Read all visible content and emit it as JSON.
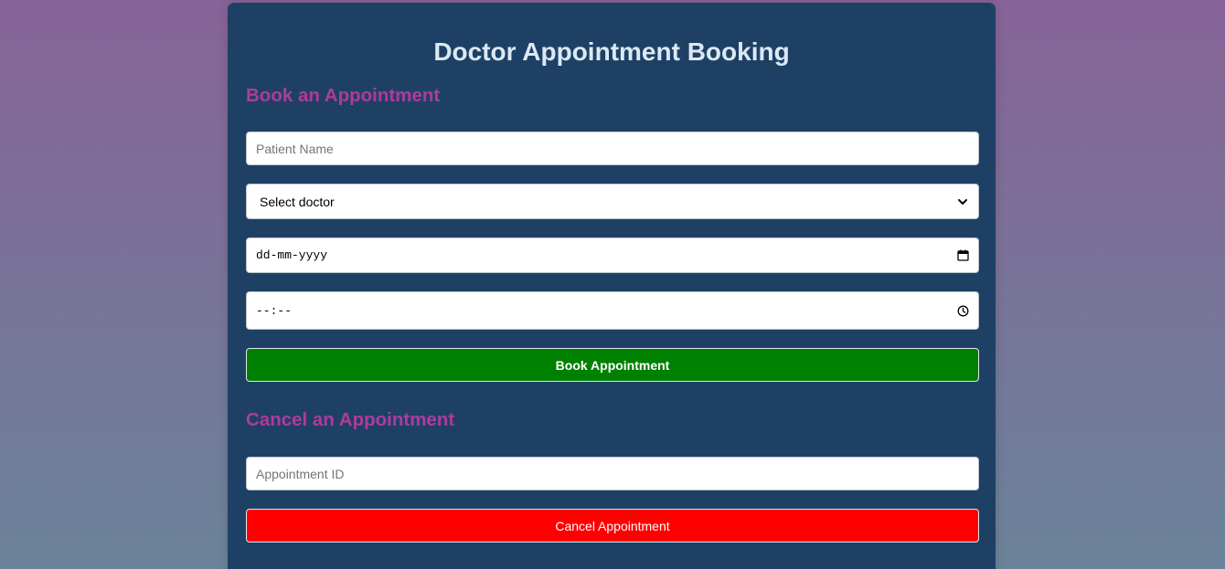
{
  "page": {
    "title": "Doctor Appointment Booking"
  },
  "book_section": {
    "heading": "Book an Appointment",
    "patient_name_placeholder": "Patient Name",
    "doctor_select_value": "Select doctor",
    "date_value": "dd-mm-yyyy",
    "time_value": "--:--",
    "submit_label": "Book Appointment"
  },
  "cancel_section": {
    "heading": "Cancel an Appointment",
    "appointment_id_placeholder": "Appointment ID",
    "submit_label": "Cancel Appointment"
  },
  "colors": {
    "card_background": "#1f4065",
    "title": "#dbe9f4",
    "section_heading": "#ae3b9b",
    "book_button": "#008000",
    "cancel_button": "#ff0000"
  },
  "icons": {
    "doctor_select": "chevron-down-icon",
    "date": "calendar-icon",
    "time": "clock-icon"
  }
}
